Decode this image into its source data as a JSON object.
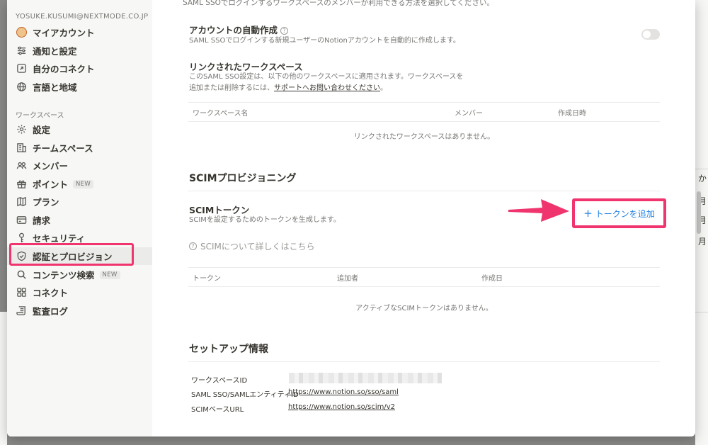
{
  "background": {
    "right_chars": [
      "か",
      "月",
      "月",
      "月"
    ]
  },
  "sidebar": {
    "email": "YOSUKE.KUSUMI@NEXTMODE.CO.JP",
    "account_items": [
      {
        "label": "マイアカウント",
        "icon": "avatar-icon"
      },
      {
        "label": "通知と設定",
        "icon": "sliders-icon"
      },
      {
        "label": "自分のコネクト",
        "icon": "link-box-icon"
      },
      {
        "label": "言語と地域",
        "icon": "globe-icon"
      }
    ],
    "workspace_section": "ワークスペース",
    "workspace_items": [
      {
        "label": "設定",
        "icon": "gear-icon"
      },
      {
        "label": "チームスペース",
        "icon": "building-icon"
      },
      {
        "label": "メンバー",
        "icon": "people-icon"
      },
      {
        "label": "ポイント",
        "icon": "gift-icon",
        "badge": "NEW"
      },
      {
        "label": "プラン",
        "icon": "map-icon"
      },
      {
        "label": "請求",
        "icon": "credit-card-icon"
      },
      {
        "label": "セキュリティ",
        "icon": "key-icon"
      },
      {
        "label": "認証とプロビジョン",
        "icon": "shield-icon",
        "active": true
      },
      {
        "label": "コンテンツ検索",
        "icon": "search-icon",
        "badge": "NEW"
      },
      {
        "label": "コネクト",
        "icon": "grid-icon"
      },
      {
        "label": "監査ログ",
        "icon": "scroll-icon"
      }
    ]
  },
  "main": {
    "top_cut_text": "SAML SSOでログインするワークスペースのメンバーが利用できる方法を選択してください。",
    "auto_create": {
      "title": "アカウントの自動作成",
      "desc": "SAML SSOでログインする新規ユーザーのNotionアカウントを自動的に作成します。",
      "toggle_on": false
    },
    "linked_workspaces": {
      "title": "リンクされたワークスペース",
      "desc_line1": "このSAML SSO設定は、以下の他のワークスペースに適用されます。ワークスペースを",
      "desc_line2_prefix": "追加または削除するには、",
      "desc_link": "サポートへお問い合わせください",
      "desc_suffix": "。",
      "columns": [
        "ワークスペース名",
        "メンバー",
        "作成日時"
      ],
      "empty": "リンクされたワークスペースはありません。"
    },
    "scim": {
      "section_title": "SCIMプロビジョニング",
      "token_title": "SCIMトークン",
      "token_desc": "SCIMを設定するためのトークンを生成します。",
      "add_button": "トークンを追加",
      "help_link": "SCIMについて詳しくはこちら",
      "columns": [
        "トークン",
        "追加者",
        "作成日"
      ],
      "empty": "アクティブなSCIMトークンはありません。"
    },
    "setup": {
      "section_title": "セットアップ情報",
      "rows": [
        {
          "label": "ワークスペースID",
          "value": ""
        },
        {
          "label": "SAML SSO/SAMLエンティティID",
          "value": "https://www.notion.so/sso/saml"
        },
        {
          "label": "SCIMベースURL",
          "value": "https://www.notion.so/scim/v2"
        }
      ]
    }
  },
  "colors": {
    "highlight": "#f0356e",
    "link_blue": "#2383e2"
  }
}
